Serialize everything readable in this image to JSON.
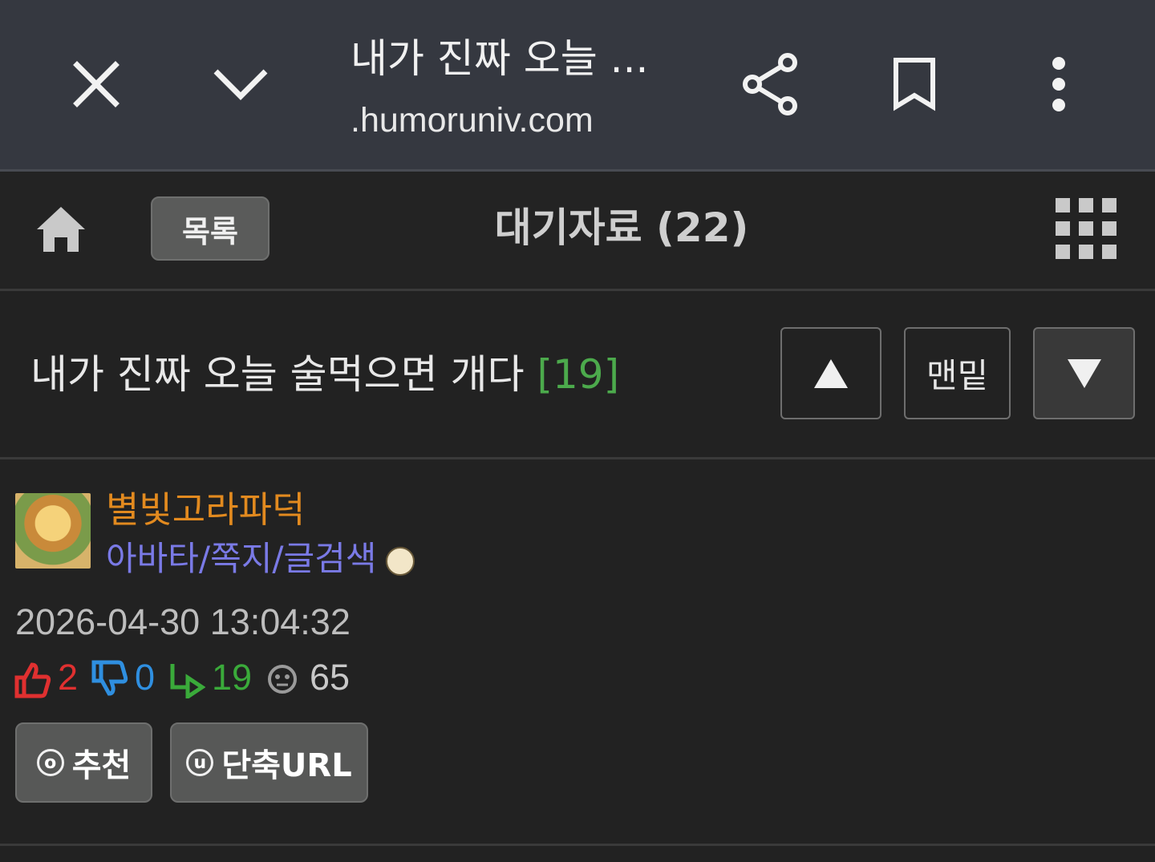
{
  "browser": {
    "title": "내가 진짜 오늘 ...",
    "url": ".humoruniv.com",
    "icons": [
      "close-icon",
      "chevron-down-icon",
      "share-icon",
      "bookmark-icon",
      "more-vert-icon"
    ]
  },
  "nav": {
    "list_label": "목록",
    "board_title": "대기자료 (22)",
    "icons": [
      "home-icon",
      "grid-menu-icon"
    ]
  },
  "post": {
    "title": "내가 진짜 오늘 술먹으면 개다",
    "comment_count": "[19]",
    "up_label": "▲",
    "bottom_label": "맨밑",
    "down_label": "▼"
  },
  "author": {
    "name": "별빛고라파덕",
    "links": "아바타/쪽지/글검색"
  },
  "meta": {
    "date": "2026-04-30 13:04:32",
    "likes": "2",
    "dislikes": "0",
    "comments": "19",
    "views": "65"
  },
  "actions": {
    "recommend_key": "o",
    "recommend_label": "추천",
    "shorturl_key": "u",
    "shorturl_label": "단축URL"
  },
  "colors": {
    "author": "#e28a1f",
    "links": "#7a7ae6",
    "like": "#e03030",
    "dislike": "#2f8fe0",
    "comment": "#3aaa3a"
  }
}
